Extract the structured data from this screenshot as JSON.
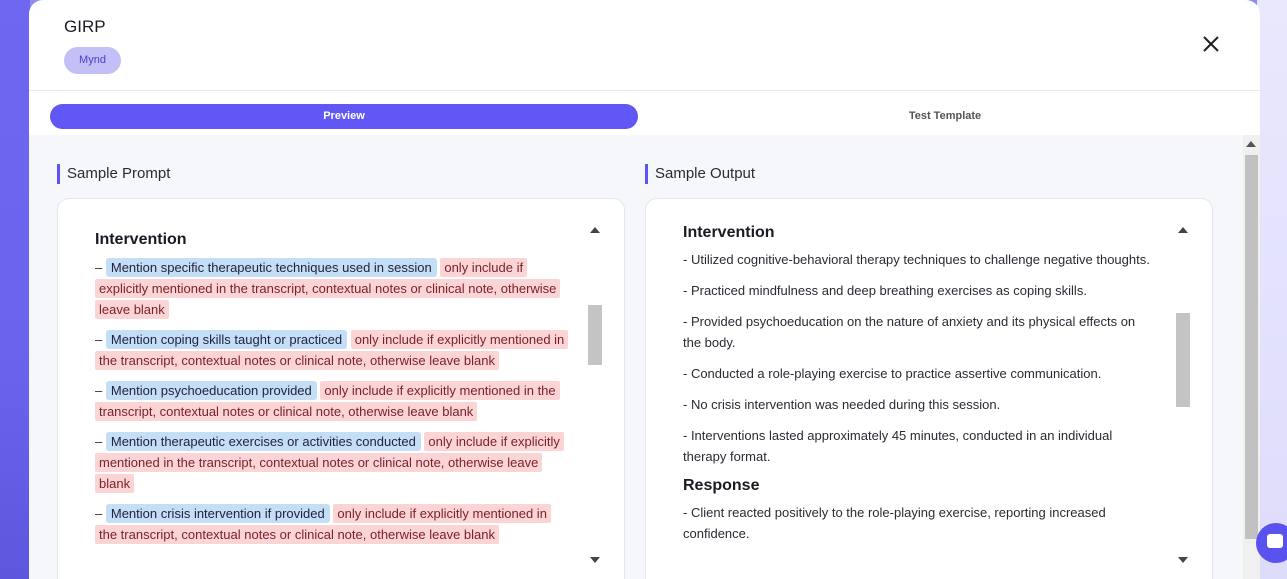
{
  "modal": {
    "title": "GIRP",
    "tag": "Mynd",
    "close_icon": "close-icon"
  },
  "tabs": [
    {
      "label": "Preview",
      "active": true
    },
    {
      "label": "Test Template",
      "active": false
    }
  ],
  "sample_prompt": {
    "title": "Sample Prompt",
    "heading": "Intervention",
    "items": [
      {
        "dash": "–",
        "instruction": "Mention specific therapeutic techniques used in session",
        "condition": "only include if explicitly mentioned in the transcript, contextual notes or clinical note, otherwise leave blank"
      },
      {
        "dash": "–",
        "instruction": "Mention coping skills taught or practiced",
        "condition": "only include if explicitly mentioned in the transcript, contextual notes or clinical note, otherwise leave blank"
      },
      {
        "dash": "–",
        "instruction": "Mention psychoeducation provided",
        "condition": "only include if explicitly mentioned in the transcript, contextual notes or clinical note, otherwise leave blank"
      },
      {
        "dash": "–",
        "instruction": "Mention therapeutic exercises or activities conducted",
        "condition": "only include if explicitly mentioned in the transcript, contextual notes or clinical note, otherwise leave blank"
      },
      {
        "dash": "–",
        "instruction": "Mention crisis intervention if provided",
        "condition": "only include if explicitly mentioned in the transcript, contextual notes or clinical note, otherwise leave blank"
      }
    ]
  },
  "sample_output": {
    "title": "Sample Output",
    "heading": "Intervention",
    "lines": [
      "- Utilized cognitive-behavioral therapy techniques to challenge negative thoughts.",
      "- Practiced mindfulness and deep breathing exercises as coping skills.",
      "- Provided psychoeducation on the nature of anxiety and its physical effects on the body.",
      "- Conducted a role-playing exercise to practice assertive communication.",
      "- No crisis intervention was needed during this session.",
      "- Interventions lasted approximately 45 minutes, conducted in an individual therapy format."
    ],
    "heading2": "Response",
    "lines2": [
      "- Client reacted positively to the role-playing exercise, reporting increased confidence."
    ]
  },
  "colors": {
    "accent": "#6157f5",
    "highlight_blue": "#c3def5",
    "highlight_red": "#fbd4d6",
    "tag_bg": "#c3c0f8"
  }
}
